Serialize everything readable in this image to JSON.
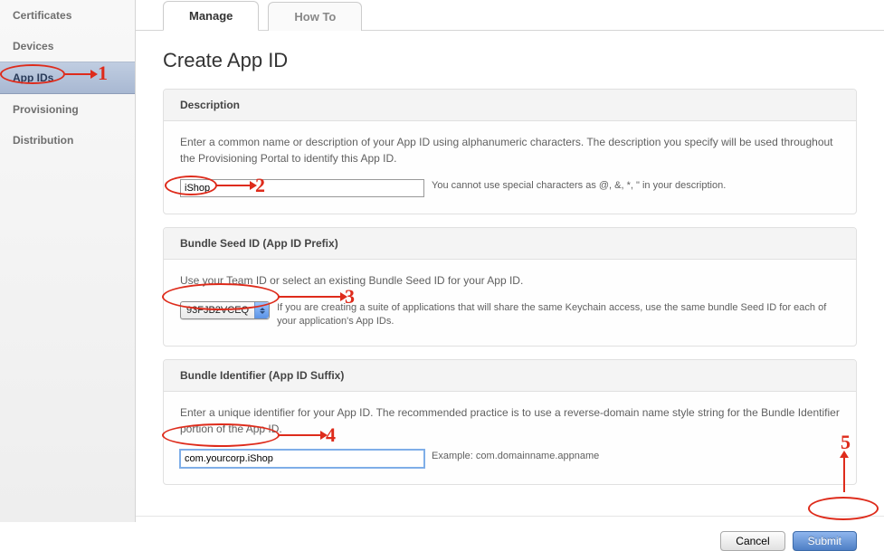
{
  "sidebar": {
    "items": [
      {
        "label": "Certificates",
        "active": false
      },
      {
        "label": "Devices",
        "active": false
      },
      {
        "label": "App IDs",
        "active": true
      },
      {
        "label": "Provisioning",
        "active": false
      },
      {
        "label": "Distribution",
        "active": false
      }
    ]
  },
  "tabs": {
    "items": [
      {
        "label": "Manage",
        "active": true
      },
      {
        "label": "How To",
        "active": false
      }
    ]
  },
  "page": {
    "title": "Create App ID"
  },
  "sections": {
    "description": {
      "header": "Description",
      "desc": "Enter a common name or description of your App ID using alphanumeric characters. The description you specify will be used throughout the Provisioning Portal to identify this App ID.",
      "value": "iShop",
      "hint": "You cannot use special characters as @, &, *, \" in your description."
    },
    "seed": {
      "header": "Bundle Seed ID (App ID Prefix)",
      "desc": "Use your Team ID or select an existing Bundle Seed ID for your App ID.",
      "selected": "93FJB2VCEQ",
      "hint": "If you are creating a suite of applications that will share the same Keychain access, use the same bundle Seed ID for each of your application's App IDs."
    },
    "bundle": {
      "header": "Bundle Identifier (App ID Suffix)",
      "desc": "Enter a unique identifier for your App ID. The recommended practice is to use a reverse-domain name style string for the Bundle Identifier portion of the App ID.",
      "value": "com.yourcorp.iShop",
      "hint": "Example: com.domainname.appname"
    }
  },
  "buttons": {
    "cancel": "Cancel",
    "submit": "Submit"
  },
  "annotations": {
    "n1": "1",
    "n2": "2",
    "n3": "3",
    "n4": "4",
    "n5": "5"
  }
}
